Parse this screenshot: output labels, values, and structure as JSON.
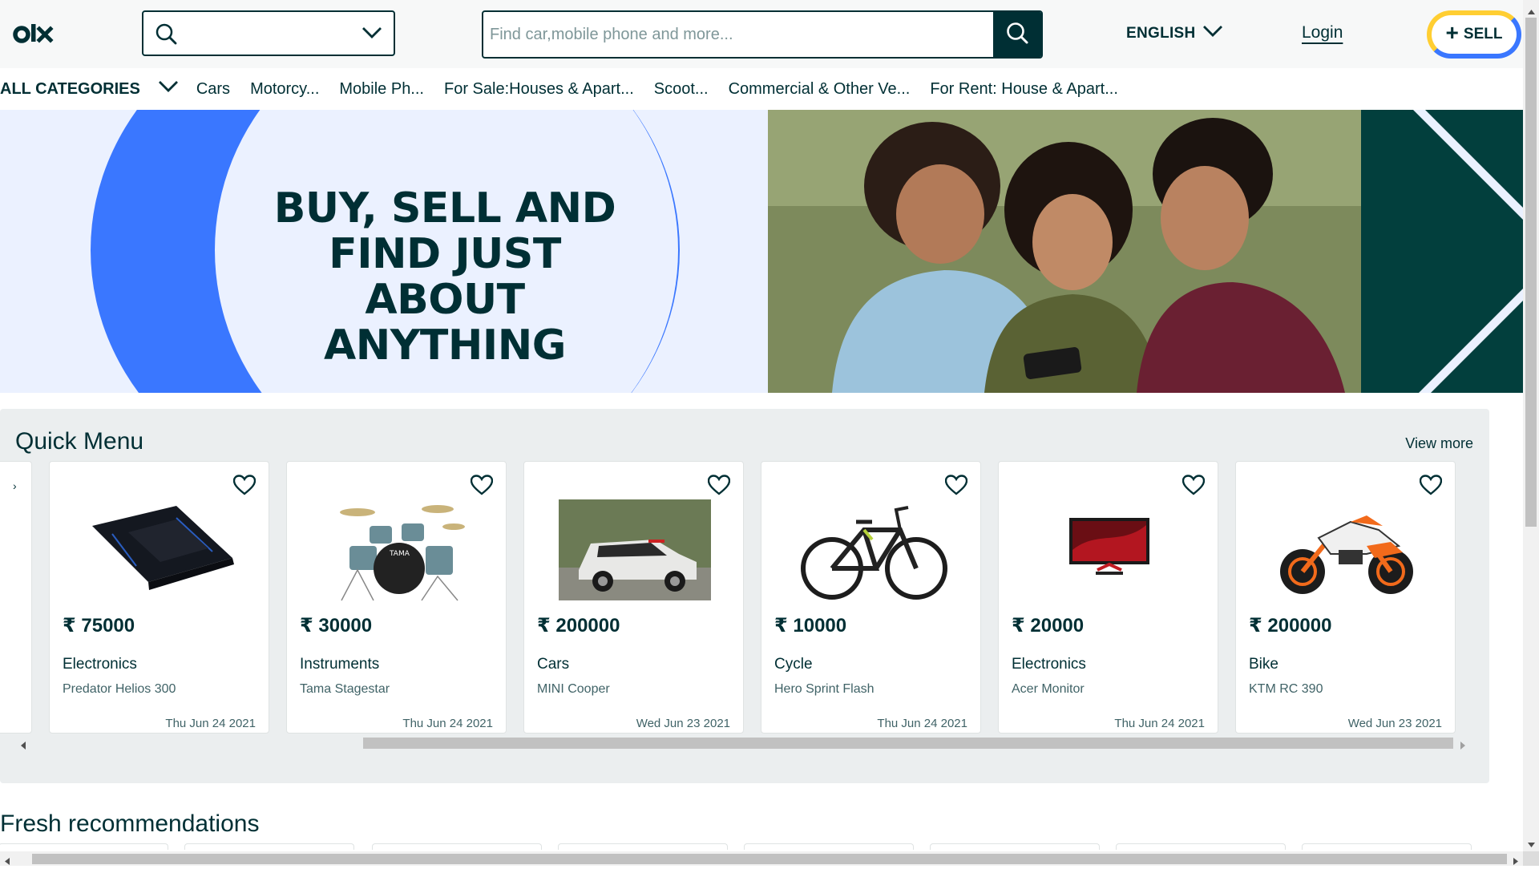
{
  "header": {
    "location_value": "",
    "search_placeholder": "Find car,mobile phone and more...",
    "language": "ENGLISH",
    "login_label": "Login",
    "sell_label": "SELL"
  },
  "categories": {
    "all_label": "ALL CATEGORIES",
    "items": [
      "Cars",
      "Motorcy...",
      "Mobile Ph...",
      "For Sale:Houses & Apart...",
      "Scoot...",
      "Commercial & Other Ve...",
      "For Rent: House & Apart..."
    ]
  },
  "banner": {
    "line1": "BUY, SELL AND",
    "line2": "FIND JUST ABOUT",
    "line3": "ANYTHING"
  },
  "quick_menu": {
    "title": "Quick Menu",
    "view_more": "View more",
    "cards": [
      {
        "price": "₹ 75000",
        "category": "Electronics",
        "title": "Predator Helios 300",
        "date": "Thu Jun 24 2021",
        "icon": "laptop-icon"
      },
      {
        "price": "₹ 30000",
        "category": "Instruments",
        "title": "Tama Stagestar",
        "date": "Thu Jun 24 2021",
        "icon": "drum-kit-icon"
      },
      {
        "price": "₹ 200000",
        "category": "Cars",
        "title": "MINI Cooper",
        "date": "Wed Jun 23 2021",
        "icon": "car-icon"
      },
      {
        "price": "₹ 10000",
        "category": "Cycle",
        "title": "Hero Sprint Flash",
        "date": "Thu Jun 24 2021",
        "icon": "bicycle-icon"
      },
      {
        "price": "₹ 20000",
        "category": "Electronics",
        "title": "Acer Monitor",
        "date": "Thu Jun 24 2021",
        "icon": "monitor-icon"
      },
      {
        "price": "₹ 200000",
        "category": "Bike",
        "title": "KTM RC 390",
        "date": "Wed Jun 23 2021",
        "icon": "motorcycle-icon"
      }
    ]
  },
  "fresh": {
    "title": "Fresh recommendations"
  },
  "colors": {
    "primary": "#002f34",
    "accent_blue": "#3a77ff",
    "accent_yellow": "#ffce32",
    "banner_bg": "#ebf1ff",
    "quick_menu_bg": "#ebeeef"
  }
}
